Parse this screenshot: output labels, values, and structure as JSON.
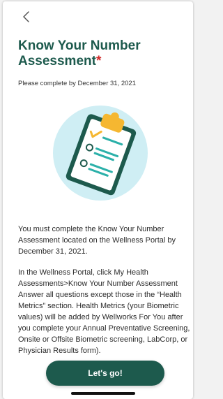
{
  "header": {
    "back_icon": "chevron-left-icon",
    "title": "Know Your Number Assessment",
    "required_marker": "*",
    "due_text": "Please complete by December 31, 2021"
  },
  "illustration": {
    "icon": "clipboard-checklist-icon",
    "colors": {
      "circle": "#cfeef4",
      "board": "#1d5a4d",
      "clip": "#f5b731",
      "check": "#f5b731",
      "lines": "#2bb0a9"
    }
  },
  "body": {
    "p1": "You must complete the Know Your Number Assessment located on the Wellness Portal by December 31, 2021.",
    "p2_line1": "In the Wellness Portal, click My Health Assessments>Know Your Number Assessment",
    "p2_line2": "Answer all questions except those in the “Health Metrics” section. Health Metrics (your Biometric values) will be added by Wellworks For You after you complete your Annual Preventative Screening, Onsite or Offsite Biometric screening, LabCorp, or Physician Results form)."
  },
  "cta": {
    "label": "Let's go!"
  },
  "colors": {
    "brand": "#1d5a4d",
    "required": "#d02a2a"
  }
}
